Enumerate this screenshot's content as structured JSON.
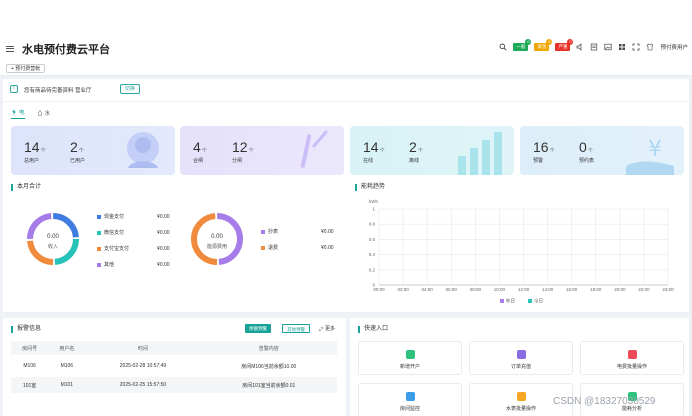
{
  "header": {
    "title": "水电预付费云平台",
    "badges": [
      {
        "label": "一般",
        "count": "0",
        "bg": "#1faa59",
        "dot": "#1faa59"
      },
      {
        "label": "紧急",
        "count": "0",
        "bg": "#f0a800",
        "dot": "#f0a800"
      },
      {
        "label": "严重",
        "count": "0",
        "bg": "#e8322a",
        "dot": "#e8322a"
      }
    ],
    "user_text": "预付费用户"
  },
  "subbar": {
    "tag": "+ 预付费营帐"
  },
  "notice": {
    "text": "您有商品待完善资料 营业厅",
    "button": "切换"
  },
  "tabs": [
    {
      "label": "电",
      "icon": "lightning-icon",
      "active": true
    },
    {
      "label": "水",
      "icon": "water-drop-icon",
      "active": false
    }
  ],
  "stat_cards": [
    {
      "bg": "#dde4fb",
      "items": [
        {
          "num": "14",
          "unit": "个",
          "label": "总用户"
        },
        {
          "num": "2",
          "unit": "个",
          "label": "已用户"
        }
      ]
    },
    {
      "bg": "#e6e1fb",
      "items": [
        {
          "num": "4",
          "unit": "个",
          "label": "合闸"
        },
        {
          "num": "12",
          "unit": "个",
          "label": "分闸"
        }
      ]
    },
    {
      "bg": "#d8f2f6",
      "items": [
        {
          "num": "14",
          "unit": "个",
          "label": "在线"
        },
        {
          "num": "2",
          "unit": "个",
          "label": "离线"
        }
      ]
    },
    {
      "bg": "#dceef9",
      "items": [
        {
          "num": "16",
          "unit": "个",
          "label": "预警"
        },
        {
          "num": "0",
          "unit": "个",
          "label": "预约表"
        }
      ]
    }
  ],
  "month_panel": {
    "title": "本月合计",
    "donut1": {
      "value": "0.00",
      "label": "收入"
    },
    "donut2": {
      "value": "0.00",
      "label": "能源费用"
    },
    "legend1": [
      {
        "label": "现金支付",
        "value": "¥0.00",
        "color": "#3f7be0"
      },
      {
        "label": "微信支付",
        "value": "¥0.00",
        "color": "#27c2b8"
      },
      {
        "label": "支付宝支付",
        "value": "¥0.00",
        "color": "#f08a3c"
      },
      {
        "label": "其他",
        "value": "¥0.00",
        "color": "#a57ce8"
      }
    ],
    "legend2": [
      {
        "label": "抄表",
        "value": "¥0.00",
        "color": "#a57ce8"
      },
      {
        "label": "退费",
        "value": "¥0.00",
        "color": "#f08a3c"
      }
    ]
  },
  "trend_panel": {
    "title": "能耗趋势",
    "ylabel": "kWh"
  },
  "chart_data": {
    "type": "line",
    "title": "",
    "xlabel": "",
    "ylabel": "kWh",
    "x": [
      "00:00",
      "02:00",
      "04:00",
      "06:00",
      "08:00",
      "10:00",
      "12:00",
      "14:00",
      "16:00",
      "18:00",
      "20:00",
      "22:00",
      "23:00"
    ],
    "yticks": [
      "0",
      "0.2",
      "0.4",
      "0.6",
      "0.8",
      "1"
    ],
    "ylim": [
      0,
      1
    ],
    "series": [
      {
        "name": "昨日",
        "values": [],
        "color": "#a57ce8"
      },
      {
        "name": "今日",
        "values": [],
        "color": "#27c2b8"
      }
    ],
    "grid": true,
    "legend": "bottom"
  },
  "alarm_panel": {
    "title": "报警信息",
    "btn1": "余额预警",
    "btn2": "其他预警",
    "more": "更多",
    "columns": [
      "房间号",
      "用户名",
      "时间",
      "告警内容"
    ],
    "rows": [
      [
        "M106",
        "M106",
        "2025-02-28 10:57:49",
        "房间M106当前余额10.00"
      ],
      [
        "101室",
        "M101",
        "2025-02-25 15:57:50",
        "房间101室当前余额0.01"
      ]
    ]
  },
  "quick_panel": {
    "title": "快速入口",
    "items": [
      {
        "label": "新增开户",
        "color": "#2fc27d"
      },
      {
        "label": "订单充值",
        "color": "#8a6be3"
      },
      {
        "label": "电费批量操作",
        "color": "#ee4b5a"
      },
      {
        "label": "房间监控",
        "color": "#3b9de8"
      },
      {
        "label": "水表批量操作",
        "color": "#f5a623"
      },
      {
        "label": "能耗分析",
        "color": "#2fc27d"
      }
    ]
  },
  "watermark": "CSDN @18327030529"
}
